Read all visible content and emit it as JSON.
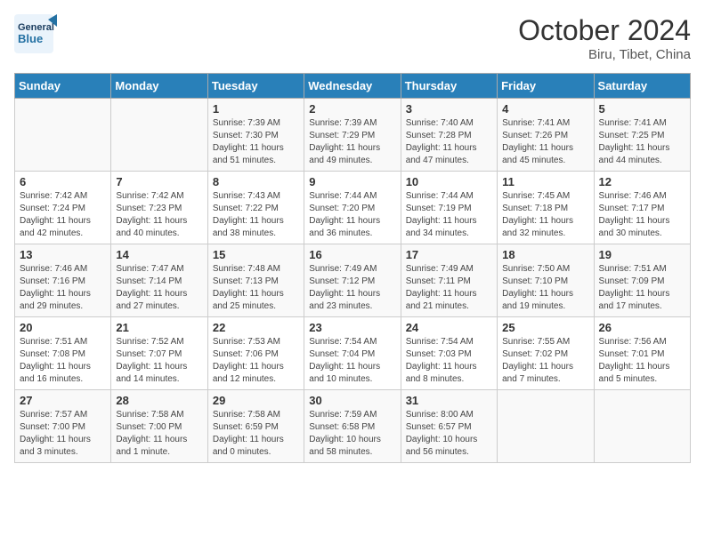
{
  "logo": {
    "line1": "General",
    "line2": "Blue"
  },
  "title": "October 2024",
  "subtitle": "Biru, Tibet, China",
  "days_header": [
    "Sunday",
    "Monday",
    "Tuesday",
    "Wednesday",
    "Thursday",
    "Friday",
    "Saturday"
  ],
  "weeks": [
    [
      {
        "day": "",
        "info": ""
      },
      {
        "day": "",
        "info": ""
      },
      {
        "day": "1",
        "info": "Sunrise: 7:39 AM\nSunset: 7:30 PM\nDaylight: 11 hours and 51 minutes."
      },
      {
        "day": "2",
        "info": "Sunrise: 7:39 AM\nSunset: 7:29 PM\nDaylight: 11 hours and 49 minutes."
      },
      {
        "day": "3",
        "info": "Sunrise: 7:40 AM\nSunset: 7:28 PM\nDaylight: 11 hours and 47 minutes."
      },
      {
        "day": "4",
        "info": "Sunrise: 7:41 AM\nSunset: 7:26 PM\nDaylight: 11 hours and 45 minutes."
      },
      {
        "day": "5",
        "info": "Sunrise: 7:41 AM\nSunset: 7:25 PM\nDaylight: 11 hours and 44 minutes."
      }
    ],
    [
      {
        "day": "6",
        "info": "Sunrise: 7:42 AM\nSunset: 7:24 PM\nDaylight: 11 hours and 42 minutes."
      },
      {
        "day": "7",
        "info": "Sunrise: 7:42 AM\nSunset: 7:23 PM\nDaylight: 11 hours and 40 minutes."
      },
      {
        "day": "8",
        "info": "Sunrise: 7:43 AM\nSunset: 7:22 PM\nDaylight: 11 hours and 38 minutes."
      },
      {
        "day": "9",
        "info": "Sunrise: 7:44 AM\nSunset: 7:20 PM\nDaylight: 11 hours and 36 minutes."
      },
      {
        "day": "10",
        "info": "Sunrise: 7:44 AM\nSunset: 7:19 PM\nDaylight: 11 hours and 34 minutes."
      },
      {
        "day": "11",
        "info": "Sunrise: 7:45 AM\nSunset: 7:18 PM\nDaylight: 11 hours and 32 minutes."
      },
      {
        "day": "12",
        "info": "Sunrise: 7:46 AM\nSunset: 7:17 PM\nDaylight: 11 hours and 30 minutes."
      }
    ],
    [
      {
        "day": "13",
        "info": "Sunrise: 7:46 AM\nSunset: 7:16 PM\nDaylight: 11 hours and 29 minutes."
      },
      {
        "day": "14",
        "info": "Sunrise: 7:47 AM\nSunset: 7:14 PM\nDaylight: 11 hours and 27 minutes."
      },
      {
        "day": "15",
        "info": "Sunrise: 7:48 AM\nSunset: 7:13 PM\nDaylight: 11 hours and 25 minutes."
      },
      {
        "day": "16",
        "info": "Sunrise: 7:49 AM\nSunset: 7:12 PM\nDaylight: 11 hours and 23 minutes."
      },
      {
        "day": "17",
        "info": "Sunrise: 7:49 AM\nSunset: 7:11 PM\nDaylight: 11 hours and 21 minutes."
      },
      {
        "day": "18",
        "info": "Sunrise: 7:50 AM\nSunset: 7:10 PM\nDaylight: 11 hours and 19 minutes."
      },
      {
        "day": "19",
        "info": "Sunrise: 7:51 AM\nSunset: 7:09 PM\nDaylight: 11 hours and 17 minutes."
      }
    ],
    [
      {
        "day": "20",
        "info": "Sunrise: 7:51 AM\nSunset: 7:08 PM\nDaylight: 11 hours and 16 minutes."
      },
      {
        "day": "21",
        "info": "Sunrise: 7:52 AM\nSunset: 7:07 PM\nDaylight: 11 hours and 14 minutes."
      },
      {
        "day": "22",
        "info": "Sunrise: 7:53 AM\nSunset: 7:06 PM\nDaylight: 11 hours and 12 minutes."
      },
      {
        "day": "23",
        "info": "Sunrise: 7:54 AM\nSunset: 7:04 PM\nDaylight: 11 hours and 10 minutes."
      },
      {
        "day": "24",
        "info": "Sunrise: 7:54 AM\nSunset: 7:03 PM\nDaylight: 11 hours and 8 minutes."
      },
      {
        "day": "25",
        "info": "Sunrise: 7:55 AM\nSunset: 7:02 PM\nDaylight: 11 hours and 7 minutes."
      },
      {
        "day": "26",
        "info": "Sunrise: 7:56 AM\nSunset: 7:01 PM\nDaylight: 11 hours and 5 minutes."
      }
    ],
    [
      {
        "day": "27",
        "info": "Sunrise: 7:57 AM\nSunset: 7:00 PM\nDaylight: 11 hours and 3 minutes."
      },
      {
        "day": "28",
        "info": "Sunrise: 7:58 AM\nSunset: 7:00 PM\nDaylight: 11 hours and 1 minute."
      },
      {
        "day": "29",
        "info": "Sunrise: 7:58 AM\nSunset: 6:59 PM\nDaylight: 11 hours and 0 minutes."
      },
      {
        "day": "30",
        "info": "Sunrise: 7:59 AM\nSunset: 6:58 PM\nDaylight: 10 hours and 58 minutes."
      },
      {
        "day": "31",
        "info": "Sunrise: 8:00 AM\nSunset: 6:57 PM\nDaylight: 10 hours and 56 minutes."
      },
      {
        "day": "",
        "info": ""
      },
      {
        "day": "",
        "info": ""
      }
    ]
  ]
}
